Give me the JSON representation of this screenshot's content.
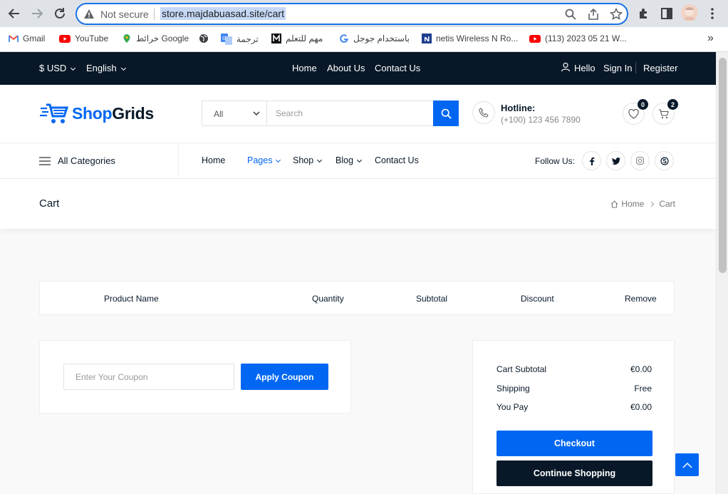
{
  "browser": {
    "security_label": "Not secure",
    "url": "store.majdabuasad.site/cart",
    "bookmarks": [
      {
        "label": "Gmail",
        "icon": "gmail-icon"
      },
      {
        "label": "YouTube",
        "icon": "youtube-icon"
      },
      {
        "label": "خرائط Google",
        "icon": "maps-icon"
      },
      {
        "label": "",
        "icon": "globe-icon"
      },
      {
        "label": "ترجمة",
        "icon": "translate-icon"
      },
      {
        "label": "مهم للتعلم",
        "icon": "m-icon"
      },
      {
        "label": "باستخدام جوجل",
        "icon": "google-icon"
      },
      {
        "label": "netis Wireless N Ro...",
        "icon": "netis-icon"
      },
      {
        "label": "(113) 2023 05 21 W...",
        "icon": "youtube-icon"
      }
    ],
    "more_bookmarks": "»"
  },
  "topbar": {
    "currency": "$ USD",
    "language": "English",
    "links": [
      "Home",
      "About Us",
      "Contact Us"
    ],
    "hello": "Hello",
    "signin": "Sign In",
    "register": "Register"
  },
  "header": {
    "logo_shop": "Shop",
    "logo_grids": "Grids",
    "category_select": "All",
    "search_placeholder": "Search",
    "hotline_label": "Hotline:",
    "hotline_number": "(+100) 123 456 7890",
    "wishlist_count": "0",
    "cart_count": "2"
  },
  "nav": {
    "all_categories": "All Categories",
    "items": [
      {
        "label": "Home",
        "dropdown": false,
        "active": false
      },
      {
        "label": "Pages",
        "dropdown": true,
        "active": true
      },
      {
        "label": "Shop",
        "dropdown": true,
        "active": false
      },
      {
        "label": "Blog",
        "dropdown": true,
        "active": false
      },
      {
        "label": "Contact Us",
        "dropdown": false,
        "active": false
      }
    ],
    "follow_us": "Follow Us:"
  },
  "breadcrumb": {
    "title": "Cart",
    "home": "Home",
    "current": "Cart"
  },
  "cart_table": {
    "columns": [
      "Product Name",
      "Quantity",
      "Subtotal",
      "Discount",
      "Remove"
    ]
  },
  "coupon": {
    "placeholder": "Enter Your Coupon",
    "button": "Apply Coupon"
  },
  "totals": {
    "subtotal_label": "Cart Subtotal",
    "subtotal_value": "€0.00",
    "shipping_label": "Shipping",
    "shipping_value": "Free",
    "pay_label": "You Pay",
    "pay_value": "€0.00",
    "checkout": "Checkout",
    "continue": "Continue Shopping"
  },
  "colors": {
    "accent": "#0167f3",
    "dark": "#081828"
  }
}
